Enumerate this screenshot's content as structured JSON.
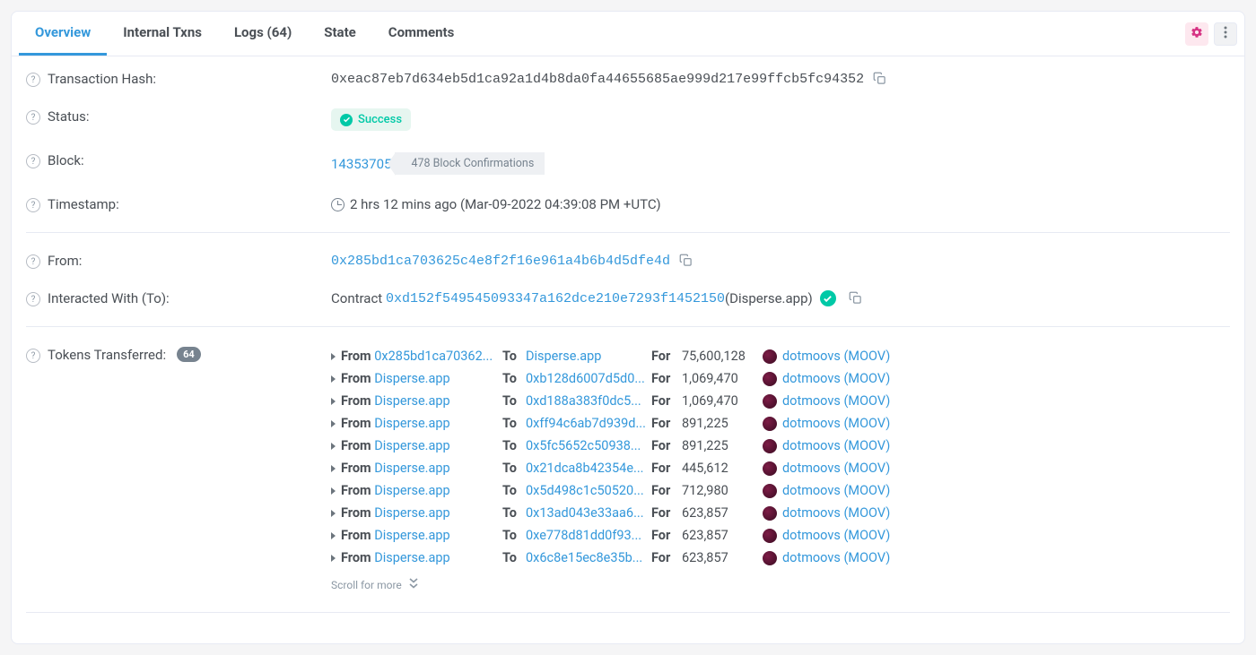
{
  "tabs": {
    "overview": "Overview",
    "internal": "Internal Txns",
    "logs": "Logs (64)",
    "state": "State",
    "comments": "Comments"
  },
  "fields": {
    "tx_hash_label": "Transaction Hash:",
    "tx_hash": "0xeac87eb7d634eb5d1ca92a1d4b8da0fa44655685ae999d217e99ffcb5fc94352",
    "status_label": "Status:",
    "status_value": "Success",
    "block_label": "Block:",
    "block_number": "14353705",
    "confirmations": "478 Block Confirmations",
    "timestamp_label": "Timestamp:",
    "timestamp_value": "2 hrs 12 mins ago (Mar-09-2022 04:39:08 PM +UTC)",
    "from_label": "From:",
    "from_address": "0x285bd1ca703625c4e8f2f16e961a4b6b4d5dfe4d",
    "to_label": "Interacted With (To):",
    "to_prefix": "Contract",
    "to_address": "0xd152f549545093347a162dce210e7293f1452150",
    "to_suffix": " (Disperse.app)",
    "tokens_label": "Tokens Transferred:",
    "tokens_count": "64",
    "scroll_more": "Scroll for more"
  },
  "transferLabels": {
    "from": "From",
    "to": "To",
    "for": "For",
    "token": "dotmoovs (MOOV)"
  },
  "transfers": [
    {
      "from": "0x285bd1ca70362...",
      "to": "Disperse.app",
      "amount": "75,600,128"
    },
    {
      "from": "Disperse.app",
      "to": "0xb128d6007d5d0...",
      "amount": "1,069,470"
    },
    {
      "from": "Disperse.app",
      "to": "0xd188a383f0dc5...",
      "amount": "1,069,470"
    },
    {
      "from": "Disperse.app",
      "to": "0xff94c6ab7d939d...",
      "amount": "891,225"
    },
    {
      "from": "Disperse.app",
      "to": "0x5fc5652c50938...",
      "amount": "891,225"
    },
    {
      "from": "Disperse.app",
      "to": "0x21dca8b42354e...",
      "amount": "445,612"
    },
    {
      "from": "Disperse.app",
      "to": "0x5d498c1c50520...",
      "amount": "712,980"
    },
    {
      "from": "Disperse.app",
      "to": "0x13ad043e33aa6...",
      "amount": "623,857"
    },
    {
      "from": "Disperse.app",
      "to": "0xe778d81dd0f93...",
      "amount": "623,857"
    },
    {
      "from": "Disperse.app",
      "to": "0x6c8e15ec8e35b...",
      "amount": "623,857"
    }
  ]
}
